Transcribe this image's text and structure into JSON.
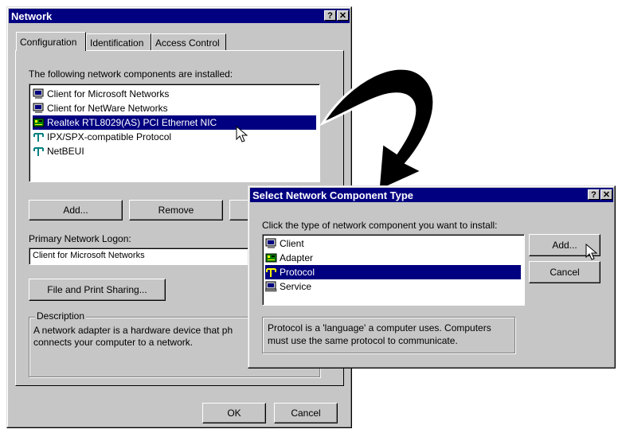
{
  "network": {
    "title": "Network",
    "help": "?",
    "close": "✕",
    "tabs": [
      "Configuration",
      "Identification",
      "Access Control"
    ],
    "components_label": "The following network components are installed:",
    "components": [
      {
        "icon": "client-icon",
        "label": "Client for Microsoft Networks"
      },
      {
        "icon": "client-icon",
        "label": "Client for NetWare Networks"
      },
      {
        "icon": "adapter-icon",
        "label": "Realtek RTL8029(AS) PCI Ethernet NIC",
        "selected": true
      },
      {
        "icon": "protocol-icon",
        "label": "IPX/SPX-compatible Protocol"
      },
      {
        "icon": "protocol-icon",
        "label": "NetBEUI"
      }
    ],
    "add": "Add...",
    "remove": "Remove",
    "primary_logon_label": "Primary Network Logon:",
    "primary_logon_value": "Client for Microsoft Networks",
    "file_print": "File and Print Sharing...",
    "description_label": "Description",
    "description_text": "A network adapter is a hardware device that ph",
    "description_text2": "connects your computer to a network.",
    "ok": "OK",
    "cancel": "Cancel"
  },
  "select_dialog": {
    "title": "Select Network Component Type",
    "help": "?",
    "close": "✕",
    "prompt": "Click the type of network component you want to install:",
    "items": [
      {
        "icon": "client-icon",
        "label": "Client"
      },
      {
        "icon": "adapter-icon",
        "label": "Adapter"
      },
      {
        "icon": "protocol-icon",
        "label": "Protocol",
        "selected": true
      },
      {
        "icon": "service-icon",
        "label": "Service"
      }
    ],
    "add": "Add...",
    "cancel": "Cancel",
    "info_line1": "Protocol is a 'language' a computer uses. Computers",
    "info_line2": "must use the same protocol to communicate."
  },
  "colors": {
    "titlebar": "#000080",
    "face": "#c6c6c6",
    "selection": "#000080"
  }
}
